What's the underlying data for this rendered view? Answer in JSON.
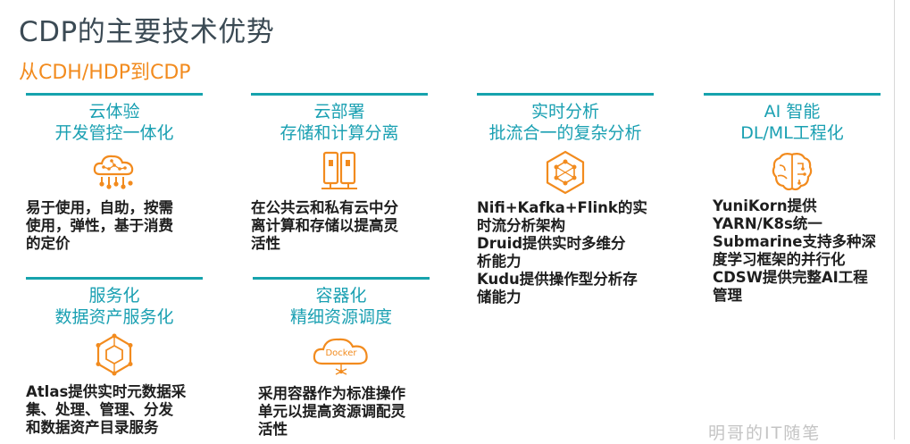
{
  "page": {
    "title": "CDP的主要技术优势",
    "subtitle": "从CDH/HDP到CDP"
  },
  "cards": [
    {
      "heading_lines": [
        "云体验",
        "开发管控一体化"
      ],
      "icon": "cloud-network-icon",
      "desc_lines": [
        "易于使用，自助，按需",
        "使用，弹性，基于消费",
        "的定价"
      ]
    },
    {
      "heading_lines": [
        "云部署",
        "存储和计算分离"
      ],
      "icon": "storage-compute-icon",
      "desc_lines": [
        "在公共云和私有云中分",
        "离计算和存储以提高灵",
        "活性"
      ]
    },
    {
      "heading_lines": [
        "实时分析",
        "批流合一的复杂分析"
      ],
      "icon": "hexagon-network-icon",
      "desc_lines": [
        "Nifi+Kafka+Flink的实",
        "时流分析架构",
        "Druid提供实时多维分",
        "析能力",
        "Kudu提供操作型分析存",
        "储能力"
      ]
    },
    {
      "heading_lines": [
        "AI 智能",
        "DL/ML工程化"
      ],
      "icon": "brain-icon",
      "desc_lines": [
        "YuniKorn提供",
        "YARN/K8s统一",
        "Submarine支持多种深",
        "度学习框架的并行化",
        "CDSW提供完整AI工程",
        "管理"
      ]
    },
    {
      "heading_lines": [
        "服务化",
        "数据资产服务化"
      ],
      "icon": "service-hexagon-icon",
      "desc_lines": [
        "Atlas提供实时元数据采",
        "集、处理、管理、分发",
        "和数据资产目录服务"
      ]
    },
    {
      "heading_lines": [
        "容器化",
        "精细资源调度"
      ],
      "icon": "docker-cloud-icon",
      "icon_text": "Docker",
      "desc_lines": [
        "采用容器作为标准操作",
        "单元以提高资源调配灵",
        "活性"
      ]
    }
  ],
  "watermark": "明哥的IT随笔",
  "colors": {
    "title": "#3b4a54",
    "subtitle": "#f28b1e",
    "accent": "#16a3ad",
    "icon": "#f28b1e"
  }
}
